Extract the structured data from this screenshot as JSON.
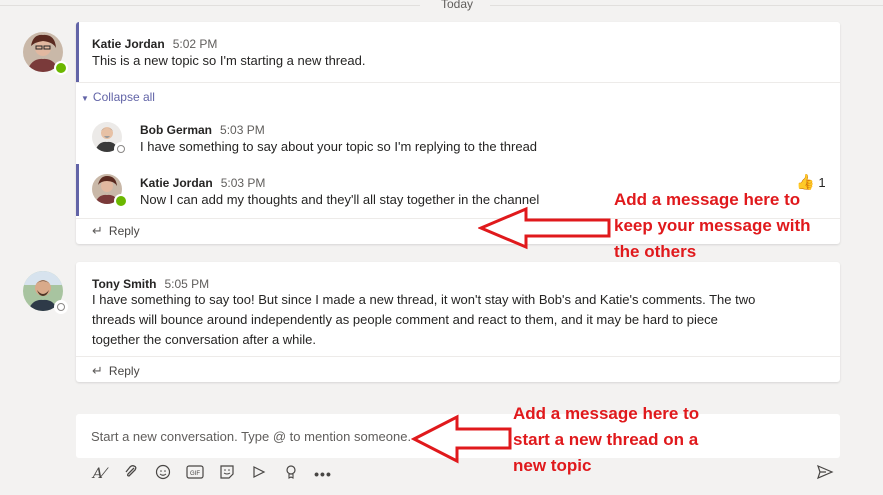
{
  "divider": {
    "label": "Today"
  },
  "thread1": {
    "root": {
      "author": "Katie Jordan",
      "time": "5:02 PM",
      "text": "This is a new topic so I'm starting a new thread."
    },
    "collapse_label": "Collapse all",
    "replies": [
      {
        "author": "Bob German",
        "time": "5:03 PM",
        "text": "I have something to say about your topic so I'm replying to the thread"
      },
      {
        "author": "Katie Jordan",
        "time": "5:03 PM",
        "text": "Now I can add my thoughts and they'll all stay together in the channel",
        "reaction_count": "1"
      }
    ],
    "reply_label": "Reply"
  },
  "thread2": {
    "root": {
      "author": "Tony Smith",
      "time": "5:05 PM",
      "lines": [
        "I have something to say too! But since I made a new thread, it won't stay with Bob's and Katie's comments. The two",
        "threads will bounce around independently as people comment and react to them, and it may be hard to piece",
        "together the conversation after a while."
      ]
    },
    "reply_label": "Reply"
  },
  "compose": {
    "placeholder": "Start a new conversation. Type @ to mention someone."
  },
  "annotations": {
    "reply_note": [
      "Add a message here to",
      "keep your message with",
      "the others"
    ],
    "new_thread_note": [
      "Add a message here to",
      "start a new thread on a",
      "new topic"
    ]
  },
  "colors": {
    "accent": "#6264a7",
    "annotation": "#e0191c",
    "presence_available": "#6bb700"
  },
  "toolbar_icons": [
    "format-icon",
    "attach-icon",
    "emoji-icon",
    "gif-icon",
    "sticker-icon",
    "meet-icon",
    "praise-icon",
    "more-icon",
    "send-icon"
  ]
}
